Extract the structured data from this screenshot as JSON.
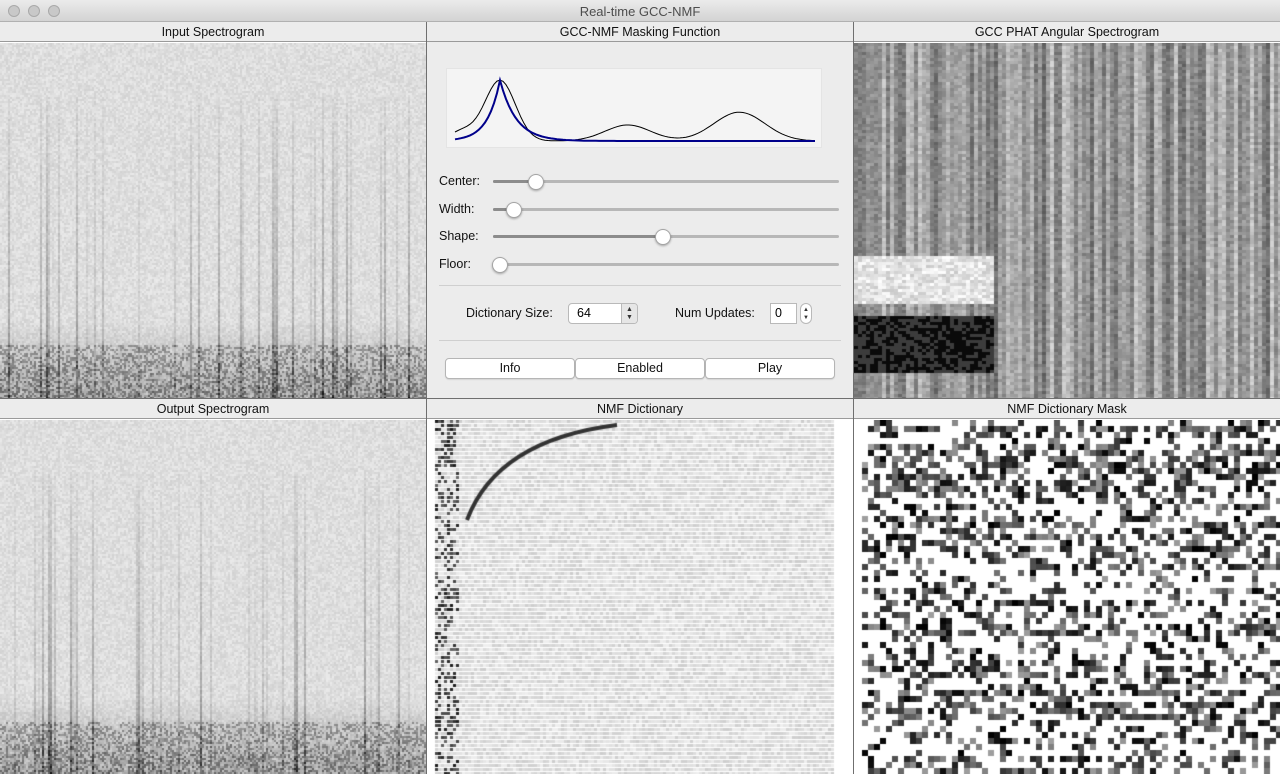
{
  "window": {
    "title": "Real-time GCC-NMF"
  },
  "panels": {
    "input_spectrogram": "Input Spectrogram",
    "masking_function": "GCC-NMF Masking Function",
    "gcc_phat": "GCC PHAT Angular Spectrogram",
    "output_spectrogram": "Output Spectrogram",
    "nmf_dictionary": "NMF Dictionary",
    "nmf_dictionary_mask": "NMF Dictionary Mask"
  },
  "sliders": [
    {
      "label": "Center:",
      "value": 0.125
    },
    {
      "label": "Width:",
      "value": 0.06
    },
    {
      "label": "Shape:",
      "value": 0.49
    },
    {
      "label": "Floor:",
      "value": 0.02
    }
  ],
  "dictionary_size": {
    "label": "Dictionary Size:",
    "value": "64"
  },
  "num_updates": {
    "label": "Num Updates:",
    "value": "0"
  },
  "buttons": {
    "info": "Info",
    "enabled": "Enabled",
    "play": "Play"
  },
  "colors": {
    "mask_curve": "#00008b",
    "gcc_curve": "#000000",
    "background": "#ececec"
  }
}
